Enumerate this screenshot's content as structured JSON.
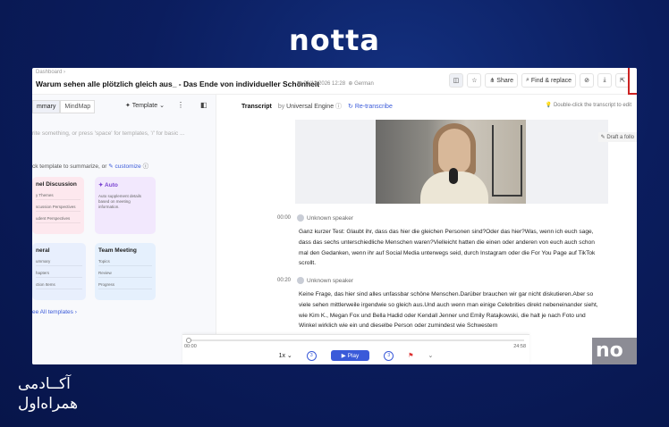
{
  "brand": "notta",
  "header": {
    "breadcrumb": "Dashboard",
    "title": "Warum sehen alle plötzlich gleich aus_ - Das Ende von individueller Schönheit",
    "date": "03/12/2026 12:28",
    "language": "German",
    "share_label": "Share",
    "find_label": "Find & replace"
  },
  "left": {
    "tab_summary": "mmary",
    "tab_mindmap": "MindMap",
    "template_label": "Template",
    "placeholder": "rite something, or press 'space' for templates, '/' for basic ...",
    "click_text": "ck template to summarize, or",
    "customize": "customize",
    "cards": [
      {
        "title": "nel Discussion",
        "lines": [
          "y Themes",
          "scussion Perspectives",
          "udent Perspectives"
        ]
      },
      {
        "title": "Auto",
        "lines": [
          "Auto supplement details based on meeting information."
        ]
      },
      {
        "title": "neral",
        "lines": [
          "ummary",
          "hapters",
          "ction Items"
        ]
      },
      {
        "title": "Team Meeting",
        "lines": [
          "Topics",
          "Review",
          "Progress"
        ]
      }
    ],
    "all_templates": "ee All templates"
  },
  "right": {
    "transcript_label": "Transcript",
    "by_label": "by",
    "engine": "Universal Engine",
    "retranscribe": "Re-transcribe",
    "hint": "Double-click the transcript to edit",
    "draft": "Draft a follo",
    "segments": [
      {
        "time": "00:00",
        "speaker": "Unknown speaker",
        "text": "Ganz kurzer Test: Glaubt ihr, dass das hier die gleichen Personen sind?Oder das hier?Was, wenn ich euch sage, dass das sechs unterschiedliche Menschen waren?Vielleicht hatten die einen oder anderen von euch auch schon mal den Gedanken, wenn ihr auf Social Media unterwegs seid, durch Instagram oder die For You Page auf TikTok scrollt."
      },
      {
        "time": "00:20",
        "speaker": "Unknown speaker",
        "text": "Keine Frage, das hier sind alles unfassbar schöne Menschen.Darüber brauchen wir gar nicht diskutieren.Aber so viele sehen mittlerweile irgendwie so gleich aus.Und auch wenn man einige Celebrities direkt nebeneinander sieht, wie Kim K., Megan Fox und Bella Hadid oder Kendall Jenner und Emily Ratajkowski, die halt je nach Foto und Winkel wirklich wie ein und dieselbe Person oder zumindest wie Schwestern"
      }
    ]
  },
  "player": {
    "current": "00:00",
    "total": "24:58",
    "speed": "1x",
    "play_label": "Play",
    "back_label": "3",
    "fwd_label": "3",
    "progress": 0
  },
  "watermark": "no",
  "footer": {
    "line1": "آکــادمی",
    "line2": "همراه‌اول"
  }
}
